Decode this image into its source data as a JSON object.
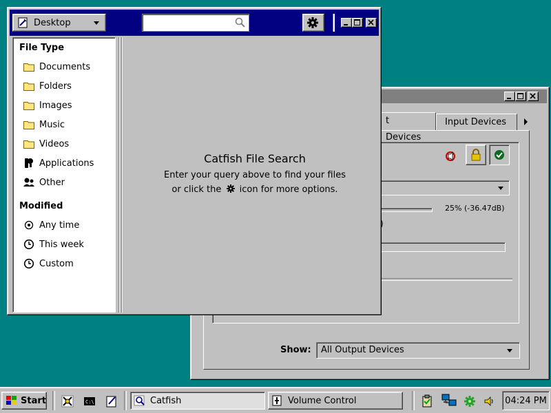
{
  "catfish": {
    "location_label": "Desktop",
    "search_value": "",
    "sidebar": {
      "file_type_heading": "File Type",
      "file_types": [
        {
          "label": "Documents",
          "icon": "folder-icon"
        },
        {
          "label": "Folders",
          "icon": "folder-icon"
        },
        {
          "label": "Images",
          "icon": "folder-icon"
        },
        {
          "label": "Music",
          "icon": "folder-icon"
        },
        {
          "label": "Videos",
          "icon": "folder-icon"
        },
        {
          "label": "Applications",
          "icon": "applications-icon"
        },
        {
          "label": "Other",
          "icon": "other-icon"
        }
      ],
      "modified_heading": "Modified",
      "modified": [
        {
          "label": "Any time",
          "selected": true
        },
        {
          "label": "This week",
          "selected": false
        },
        {
          "label": "Custom",
          "selected": false
        }
      ]
    },
    "main": {
      "title": "Catfish File Search",
      "line1": "Enter your query above to find your files",
      "line2_before": "or click the",
      "line2_after": "icon for more options."
    }
  },
  "volume": {
    "tab_output_partial": "t Devices",
    "tab_input": "Input Devices",
    "level_text": "25% (-36.47dB)",
    "partial_paren": ")",
    "show_label": "Show:",
    "show_value": "All Output Devices"
  },
  "taskbar": {
    "start_label": "Start",
    "tasks": [
      {
        "label": "Catfish",
        "active": true
      },
      {
        "label": "Volume Control",
        "active": false
      }
    ],
    "clock": "04:24 PM"
  },
  "colors": {
    "desktop": "#008080",
    "active_title": "#000080",
    "inactive_title": "#808080",
    "face": "#c0c0c0"
  }
}
